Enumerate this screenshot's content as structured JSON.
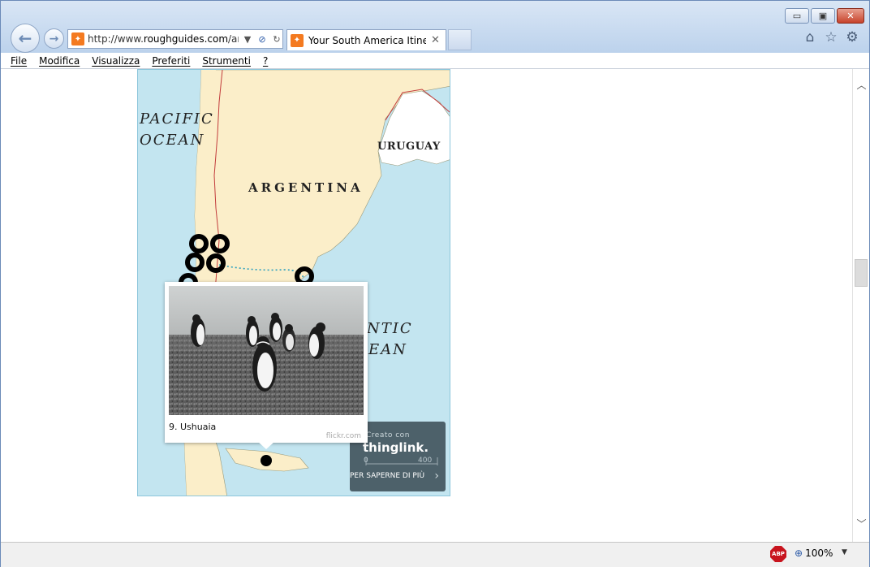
{
  "browser": {
    "url_prefix": "http://www.",
    "url_domain": "roughguides.com",
    "url_suffix": "/artic",
    "tab_title": "Your South America Itinera...",
    "tab_close": "✕",
    "window_buttons": {
      "minimize": "▭",
      "maximize": "▣",
      "close": "✕"
    },
    "nav": {
      "back": "←",
      "forward": "→"
    }
  },
  "menu": [
    "File",
    "Modifica",
    "Visualizza",
    "Preferiti",
    "Strumenti",
    "?"
  ],
  "map": {
    "labels": {
      "pacific_line1": "PACIFIC",
      "pacific_line2": "OCEAN",
      "argentina": "ARGENTINA",
      "uruguay": "URUGUAY",
      "atlantic_line1": "NTIC",
      "atlantic_line2": "EAN"
    },
    "colors": {
      "land": "#fbeec9",
      "water": "#c3e5f0",
      "border": "#c23b3b",
      "marker": "#000000"
    }
  },
  "popup": {
    "caption": "9. Ushuaia",
    "source": "flickr.com"
  },
  "thinglink": {
    "created_with": "Creato con",
    "logo": "thinglink.",
    "learn_more": "PER SAPERNE DI PIÙ",
    "scale_start": "0",
    "scale_end": "400"
  },
  "status": {
    "zoom": "100%",
    "adblock": "ABP"
  }
}
